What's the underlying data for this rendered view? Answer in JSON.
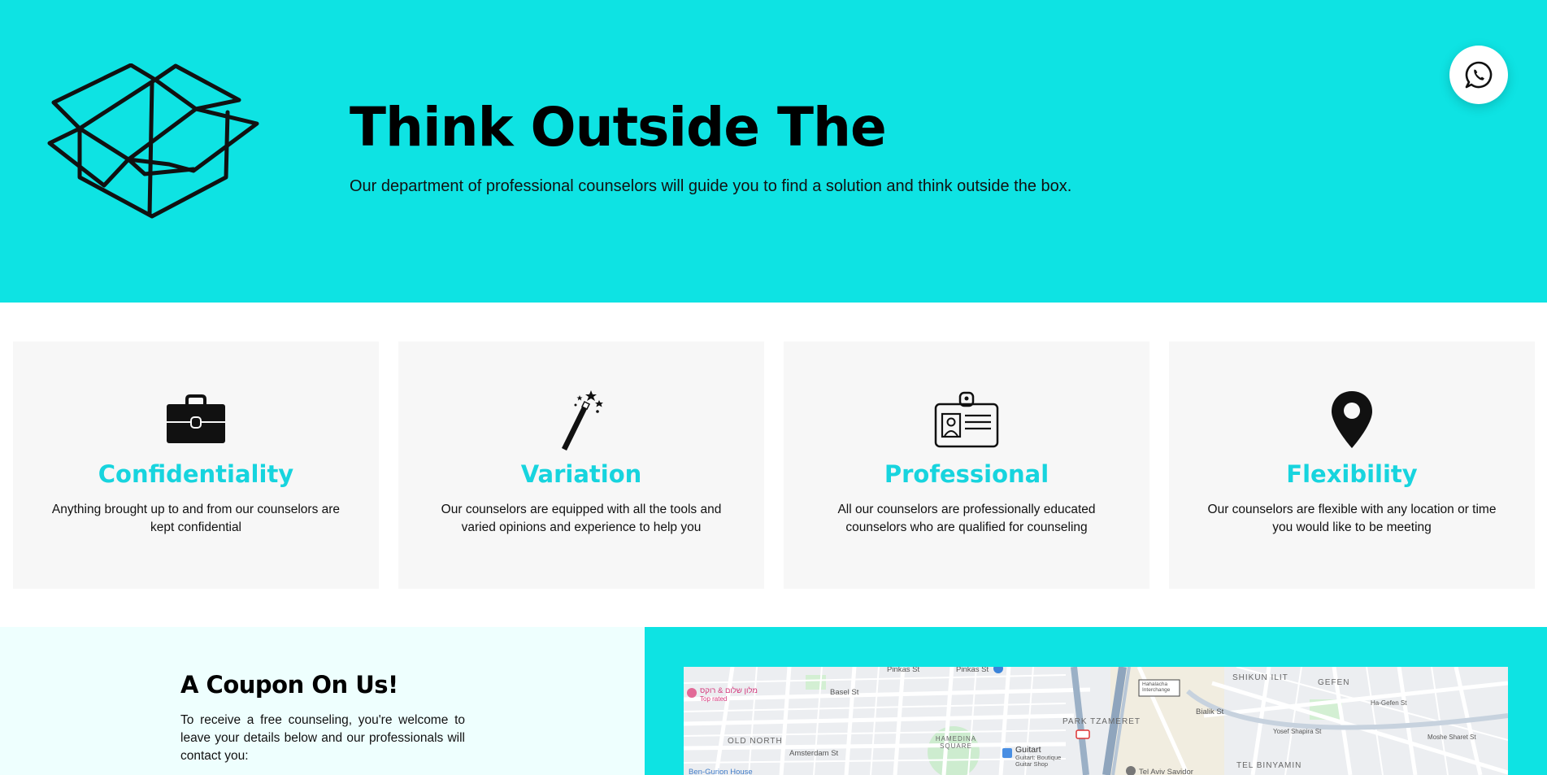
{
  "hero": {
    "title": "Think Outside The",
    "subtitle": "Our department of professional counselors will guide you to find a solution and think outside the box.",
    "box_icon": "open-box-icon",
    "whatsapp_icon": "whatsapp-icon",
    "background_color": "#0ee3e3"
  },
  "features": [
    {
      "icon": "briefcase-icon",
      "title": "Confidentiality",
      "text": "Anything brought up to and from our counselors are kept confidential"
    },
    {
      "icon": "magic-wand-icon",
      "title": "Variation",
      "text": "Our counselors are equipped with all the tools and varied opinions and experience to help you"
    },
    {
      "icon": "id-badge-icon",
      "title": "Professional",
      "text": "All our counselors are professionally educated counselors who are qualified for counseling"
    },
    {
      "icon": "location-pin-icon",
      "title": "Flexibility",
      "text": "Our counselors are flexible with any location or time you would like to be meeting"
    }
  ],
  "accent_color": "#17d4de",
  "coupon": {
    "title": "A Coupon On Us!",
    "text": "To receive a free counseling, you're welcome to leave your details below and our professionals will contact you:"
  },
  "map": {
    "labels": {
      "pinkas1": "Pinkas St",
      "pinkas2": "Pinkas St",
      "basel": "Basel St",
      "old_north": "OLD NORTH",
      "hamedina": "HAMEDINA SQUARE",
      "amsterdam": "Amsterdam St",
      "park_tzameret": "PARK TZAMERET",
      "shikun_ilit": "SHIKUN ILIT",
      "gefen": "GEFEN",
      "tel_binyamin": "TEL BINYAMIN",
      "bialik": "Bialik St",
      "hotel": "מלון שלום & רוקס",
      "hotel_sub": "Top rated",
      "guitart": "Guitart",
      "guitart_sub": "Guitart: Boutique Guitar Shop",
      "interchange": "Hahalacha Interchange",
      "ben_gurion": "Ben-Gurion House",
      "tel_aviv_savidor": "Tel Aviv Savidor",
      "ha_gefen": "Ha-Gefen St",
      "moshe_sharet": "Moshe Sharet St",
      "yosef_shapira": "Yosef Shapira St"
    }
  }
}
